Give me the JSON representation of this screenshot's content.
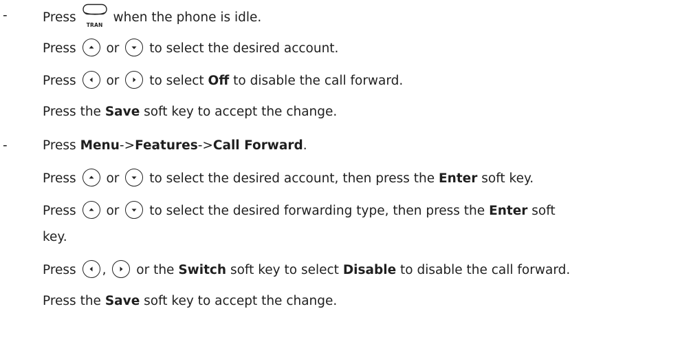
{
  "list_marker": "-",
  "section_1": {
    "step_1": {
      "pre": "Press",
      "key_label": "TRAN",
      "post": "when the phone is idle."
    },
    "step_2": {
      "pre": "Press",
      "mid": "or",
      "post": "to select the desired account."
    },
    "step_3": {
      "pre": "Press",
      "mid": "or",
      "post_a": "to select",
      "bold": "Off",
      "post_b": "to disable the call forward."
    },
    "step_4": {
      "pre": "Press the",
      "bold": "Save",
      "post": "soft key to accept the change."
    }
  },
  "section_2": {
    "step_1": {
      "pre": "Press",
      "b1": "Menu",
      "sep1": "->",
      "b2": "Features",
      "sep2": "->",
      "b3": "Call Forward",
      "end": "."
    },
    "step_2": {
      "pre": "Press",
      "mid": "or",
      "post_a": "to select the desired account, then press the",
      "bold": "Enter",
      "post_b": "soft key."
    },
    "step_3": {
      "pre": "Press",
      "mid": "or",
      "post_a": "to select the desired forwarding type, then press the",
      "bold": "Enter",
      "post_b": "soft",
      "wrap": "key."
    },
    "step_4": {
      "pre": "Press",
      "comma": ",",
      "mid": "or the",
      "bold1": "Switch",
      "post_a": "soft key to select",
      "bold2": "Disable",
      "post_b": "to disable the call forward."
    },
    "step_5": {
      "pre": "Press the",
      "bold": "Save",
      "post": "soft key to accept the change."
    }
  },
  "icons": {
    "up": "up-arrow-key-icon",
    "down": "down-arrow-key-icon",
    "left": "left-arrow-key-icon",
    "right": "right-arrow-key-icon",
    "tran": "tran-key-icon"
  }
}
